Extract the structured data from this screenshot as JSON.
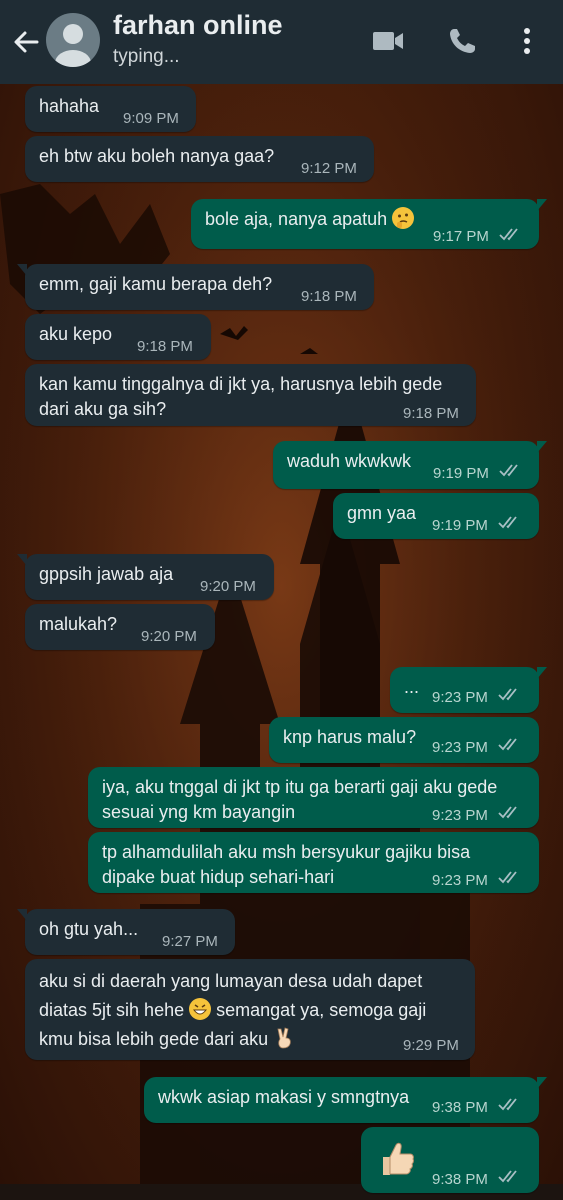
{
  "header": {
    "contact_name": "farhan online",
    "status": "typing...",
    "icons": [
      "back-arrow-icon",
      "avatar",
      "video-call-icon",
      "voice-call-icon",
      "more-vert-icon"
    ]
  },
  "colors": {
    "header_bg": "#1f2c34",
    "incoming_bubble": "#1f2c34",
    "outgoing_bubble": "#005c4b",
    "read_ticks": "#a8bfc4"
  },
  "messages": [
    {
      "dir": "in",
      "text": "hahaha",
      "time": "9:09 PM"
    },
    {
      "dir": "in",
      "text": "eh btw aku boleh nanya gaa?",
      "time": "9:12 PM"
    },
    {
      "dir": "out",
      "text": "bole aja, nanya apatuh",
      "emoji": "thinking-face",
      "time": "9:17 PM",
      "read": true
    },
    {
      "dir": "in",
      "text": "emm, gaji kamu berapa deh?",
      "time": "9:18 PM"
    },
    {
      "dir": "in",
      "text": "aku kepo",
      "time": "9:18 PM"
    },
    {
      "dir": "in",
      "text": "kan kamu tinggalnya di jkt ya, harusnya lebih gede dari aku ga sih?",
      "time": "9:18 PM"
    },
    {
      "dir": "out",
      "text": "waduh wkwkwk",
      "time": "9:19 PM",
      "read": true
    },
    {
      "dir": "out",
      "text": "gmn yaa",
      "time": "9:19 PM",
      "read": true
    },
    {
      "dir": "in",
      "text": "gppsih jawab aja",
      "time": "9:20 PM"
    },
    {
      "dir": "in",
      "text": "malukah?",
      "time": "9:20 PM"
    },
    {
      "dir": "out",
      "text": "...",
      "time": "9:23 PM",
      "read": true
    },
    {
      "dir": "out",
      "text": "knp harus malu?",
      "time": "9:23 PM",
      "read": true
    },
    {
      "dir": "out",
      "text": "iya, aku tnggal di jkt tp itu ga berarti gaji aku gede sesuai yng km bayangin",
      "time": "9:23 PM",
      "read": true
    },
    {
      "dir": "out",
      "text": "tp alhamdulilah aku msh bersyukur gajiku bisa dipake buat hidup sehari-hari",
      "time": "9:23 PM",
      "read": true
    },
    {
      "dir": "in",
      "text": "oh gtu yah...",
      "time": "9:27 PM"
    },
    {
      "dir": "in",
      "text_a": "aku si di daerah yang lumayan desa udah dapet diatas 5jt sih hehe",
      "emoji_a": "grinning-face",
      "text_b": "semangat ya, semoga gaji kmu bisa lebih gede dari aku",
      "emoji_b": "victory-hand",
      "time": "9:29 PM"
    },
    {
      "dir": "out",
      "text": "wkwk asiap makasi y smngtnya",
      "time": "9:38 PM",
      "read": true
    },
    {
      "dir": "out",
      "emoji": "thumbs-up",
      "time": "9:38 PM",
      "read": true
    }
  ]
}
